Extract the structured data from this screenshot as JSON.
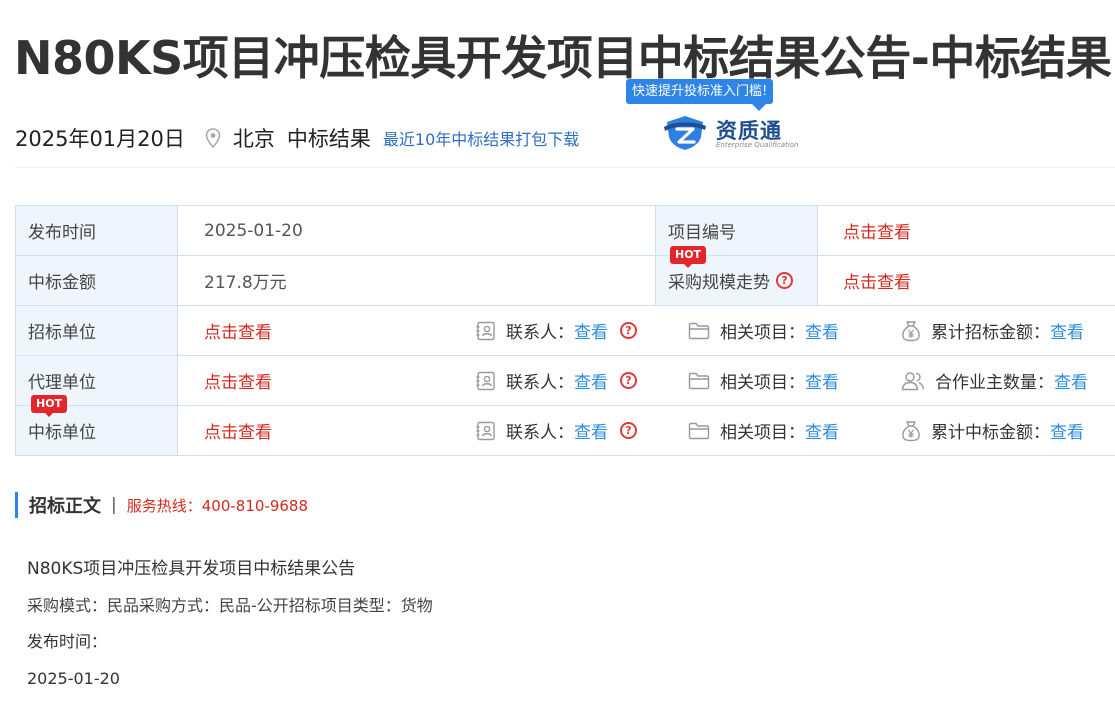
{
  "title": "N80KS项目冲压检具开发项目中标结果公告-中标结果",
  "meta": {
    "date": "2025年01月20日",
    "city": "北京",
    "type": "中标结果",
    "download_link": "最近10年中标结果打包下载"
  },
  "promo": {
    "bubble": "快速提升投标准入门槛!",
    "brand": "资质通",
    "brand_sub": "Enterprise Qualification"
  },
  "info_table": {
    "publish_time_label": "发布时间",
    "publish_time": "2025-01-20",
    "project_no_label": "项目编号",
    "project_no_value": "点击查看",
    "amount_label": "中标金额",
    "amount": "217.8万元",
    "trend_label": "采购规模走势",
    "trend_value": "点击查看",
    "hot_badge": "HOT",
    "rows": [
      {
        "label": "招标单位",
        "value": "点击查看",
        "contact_label": "联系人：",
        "contact_value": "查看",
        "related_label": "相关项目：",
        "related_value": "查看",
        "extra_label": "累计招标金额：",
        "extra_value": "查看"
      },
      {
        "label": "代理单位",
        "value": "点击查看",
        "contact_label": "联系人：",
        "contact_value": "查看",
        "related_label": "相关项目：",
        "related_value": "查看",
        "extra_label": "合作业主数量：",
        "extra_value": "查看"
      },
      {
        "label": "中标单位",
        "value": "点击查看",
        "contact_label": "联系人：",
        "contact_value": "查看",
        "related_label": "相关项目：",
        "related_value": "查看",
        "extra_label": "累计中标金额：",
        "extra_value": "查看"
      }
    ]
  },
  "section": {
    "heading": "招标正文",
    "separator": "|",
    "hotline": "服务热线：400-810-9688"
  },
  "content": {
    "line1": "N80KS项目冲压检具开发项目中标结果公告",
    "line2": "采购模式：民品采购方式：民品-公开招标项目类型：货物",
    "line3": "发布时间：",
    "line4": "2025-01-20"
  },
  "colors": {
    "accent": "#2d85e6",
    "link_blue": "#2d8cdc",
    "link_red": "#d5291f",
    "label_bg": "#eef5fc",
    "border": "#cfe0f0"
  }
}
